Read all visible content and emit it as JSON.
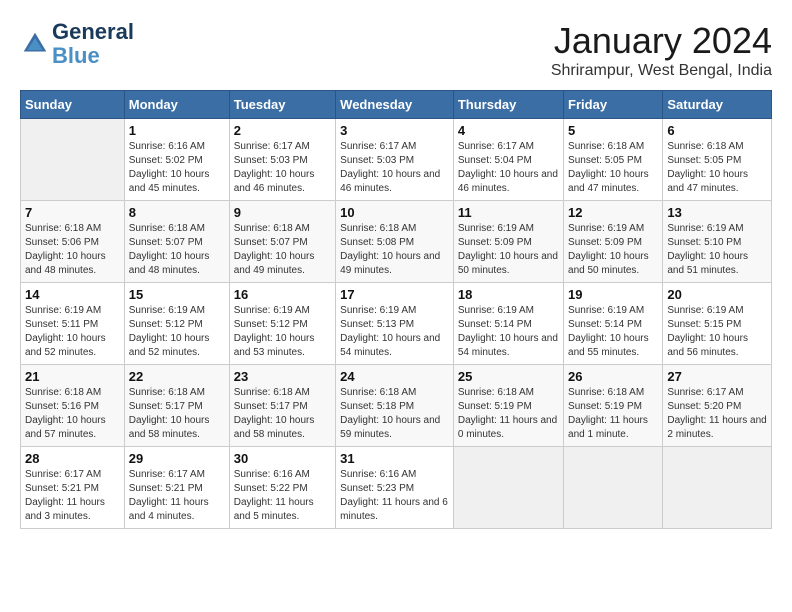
{
  "header": {
    "logo": {
      "line1": "General",
      "line2": "Blue",
      "icon": "▶"
    },
    "title": "January 2024",
    "subtitle": "Shrirampur, West Bengal, India"
  },
  "calendar": {
    "days_of_week": [
      "Sunday",
      "Monday",
      "Tuesday",
      "Wednesday",
      "Thursday",
      "Friday",
      "Saturday"
    ],
    "weeks": [
      [
        {
          "day": "",
          "sunrise": "",
          "sunset": "",
          "daylight": ""
        },
        {
          "day": "1",
          "sunrise": "Sunrise: 6:16 AM",
          "sunset": "Sunset: 5:02 PM",
          "daylight": "Daylight: 10 hours and 45 minutes."
        },
        {
          "day": "2",
          "sunrise": "Sunrise: 6:17 AM",
          "sunset": "Sunset: 5:03 PM",
          "daylight": "Daylight: 10 hours and 46 minutes."
        },
        {
          "day": "3",
          "sunrise": "Sunrise: 6:17 AM",
          "sunset": "Sunset: 5:03 PM",
          "daylight": "Daylight: 10 hours and 46 minutes."
        },
        {
          "day": "4",
          "sunrise": "Sunrise: 6:17 AM",
          "sunset": "Sunset: 5:04 PM",
          "daylight": "Daylight: 10 hours and 46 minutes."
        },
        {
          "day": "5",
          "sunrise": "Sunrise: 6:18 AM",
          "sunset": "Sunset: 5:05 PM",
          "daylight": "Daylight: 10 hours and 47 minutes."
        },
        {
          "day": "6",
          "sunrise": "Sunrise: 6:18 AM",
          "sunset": "Sunset: 5:05 PM",
          "daylight": "Daylight: 10 hours and 47 minutes."
        }
      ],
      [
        {
          "day": "7",
          "sunrise": "Sunrise: 6:18 AM",
          "sunset": "Sunset: 5:06 PM",
          "daylight": "Daylight: 10 hours and 48 minutes."
        },
        {
          "day": "8",
          "sunrise": "Sunrise: 6:18 AM",
          "sunset": "Sunset: 5:07 PM",
          "daylight": "Daylight: 10 hours and 48 minutes."
        },
        {
          "day": "9",
          "sunrise": "Sunrise: 6:18 AM",
          "sunset": "Sunset: 5:07 PM",
          "daylight": "Daylight: 10 hours and 49 minutes."
        },
        {
          "day": "10",
          "sunrise": "Sunrise: 6:18 AM",
          "sunset": "Sunset: 5:08 PM",
          "daylight": "Daylight: 10 hours and 49 minutes."
        },
        {
          "day": "11",
          "sunrise": "Sunrise: 6:19 AM",
          "sunset": "Sunset: 5:09 PM",
          "daylight": "Daylight: 10 hours and 50 minutes."
        },
        {
          "day": "12",
          "sunrise": "Sunrise: 6:19 AM",
          "sunset": "Sunset: 5:09 PM",
          "daylight": "Daylight: 10 hours and 50 minutes."
        },
        {
          "day": "13",
          "sunrise": "Sunrise: 6:19 AM",
          "sunset": "Sunset: 5:10 PM",
          "daylight": "Daylight: 10 hours and 51 minutes."
        }
      ],
      [
        {
          "day": "14",
          "sunrise": "Sunrise: 6:19 AM",
          "sunset": "Sunset: 5:11 PM",
          "daylight": "Daylight: 10 hours and 52 minutes."
        },
        {
          "day": "15",
          "sunrise": "Sunrise: 6:19 AM",
          "sunset": "Sunset: 5:12 PM",
          "daylight": "Daylight: 10 hours and 52 minutes."
        },
        {
          "day": "16",
          "sunrise": "Sunrise: 6:19 AM",
          "sunset": "Sunset: 5:12 PM",
          "daylight": "Daylight: 10 hours and 53 minutes."
        },
        {
          "day": "17",
          "sunrise": "Sunrise: 6:19 AM",
          "sunset": "Sunset: 5:13 PM",
          "daylight": "Daylight: 10 hours and 54 minutes."
        },
        {
          "day": "18",
          "sunrise": "Sunrise: 6:19 AM",
          "sunset": "Sunset: 5:14 PM",
          "daylight": "Daylight: 10 hours and 54 minutes."
        },
        {
          "day": "19",
          "sunrise": "Sunrise: 6:19 AM",
          "sunset": "Sunset: 5:14 PM",
          "daylight": "Daylight: 10 hours and 55 minutes."
        },
        {
          "day": "20",
          "sunrise": "Sunrise: 6:19 AM",
          "sunset": "Sunset: 5:15 PM",
          "daylight": "Daylight: 10 hours and 56 minutes."
        }
      ],
      [
        {
          "day": "21",
          "sunrise": "Sunrise: 6:18 AM",
          "sunset": "Sunset: 5:16 PM",
          "daylight": "Daylight: 10 hours and 57 minutes."
        },
        {
          "day": "22",
          "sunrise": "Sunrise: 6:18 AM",
          "sunset": "Sunset: 5:17 PM",
          "daylight": "Daylight: 10 hours and 58 minutes."
        },
        {
          "day": "23",
          "sunrise": "Sunrise: 6:18 AM",
          "sunset": "Sunset: 5:17 PM",
          "daylight": "Daylight: 10 hours and 58 minutes."
        },
        {
          "day": "24",
          "sunrise": "Sunrise: 6:18 AM",
          "sunset": "Sunset: 5:18 PM",
          "daylight": "Daylight: 10 hours and 59 minutes."
        },
        {
          "day": "25",
          "sunrise": "Sunrise: 6:18 AM",
          "sunset": "Sunset: 5:19 PM",
          "daylight": "Daylight: 11 hours and 0 minutes."
        },
        {
          "day": "26",
          "sunrise": "Sunrise: 6:18 AM",
          "sunset": "Sunset: 5:19 PM",
          "daylight": "Daylight: 11 hours and 1 minute."
        },
        {
          "day": "27",
          "sunrise": "Sunrise: 6:17 AM",
          "sunset": "Sunset: 5:20 PM",
          "daylight": "Daylight: 11 hours and 2 minutes."
        }
      ],
      [
        {
          "day": "28",
          "sunrise": "Sunrise: 6:17 AM",
          "sunset": "Sunset: 5:21 PM",
          "daylight": "Daylight: 11 hours and 3 minutes."
        },
        {
          "day": "29",
          "sunrise": "Sunrise: 6:17 AM",
          "sunset": "Sunset: 5:21 PM",
          "daylight": "Daylight: 11 hours and 4 minutes."
        },
        {
          "day": "30",
          "sunrise": "Sunrise: 6:16 AM",
          "sunset": "Sunset: 5:22 PM",
          "daylight": "Daylight: 11 hours and 5 minutes."
        },
        {
          "day": "31",
          "sunrise": "Sunrise: 6:16 AM",
          "sunset": "Sunset: 5:23 PM",
          "daylight": "Daylight: 11 hours and 6 minutes."
        },
        {
          "day": "",
          "sunrise": "",
          "sunset": "",
          "daylight": ""
        },
        {
          "day": "",
          "sunrise": "",
          "sunset": "",
          "daylight": ""
        },
        {
          "day": "",
          "sunrise": "",
          "sunset": "",
          "daylight": ""
        }
      ]
    ]
  }
}
